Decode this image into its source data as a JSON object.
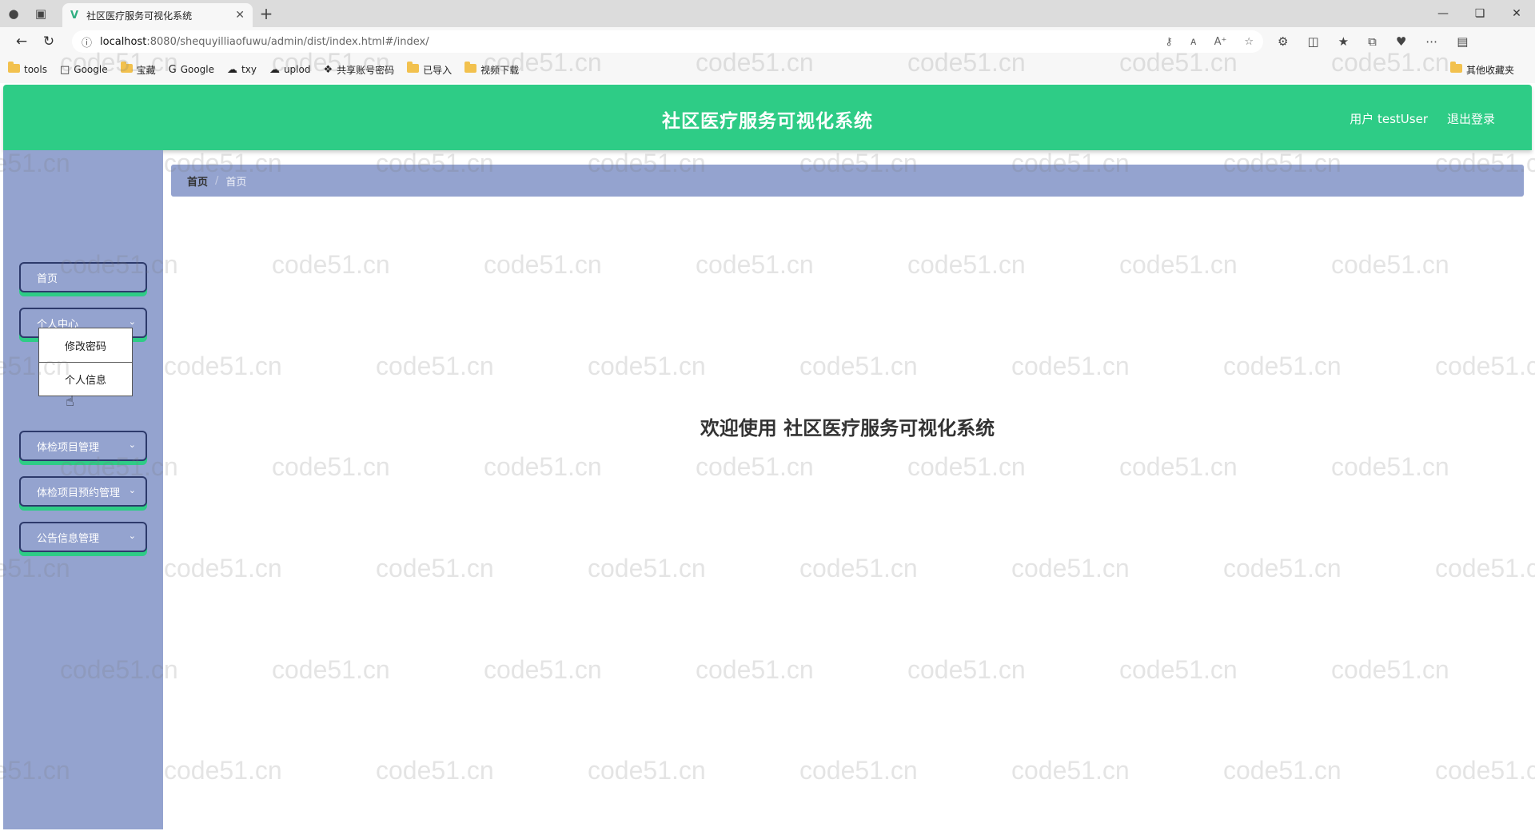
{
  "browser": {
    "tab_title": "社区医疗服务可视化系统",
    "url_host": "localhost",
    "url_path": ":8080/shequyilliaofuwu/admin/dist/index.html#/index/",
    "bookmarks": [
      "tools",
      "Google",
      "宝藏",
      "Google",
      "txy",
      "uplod",
      "共享账号密码",
      "已导入",
      "视频下载"
    ],
    "bookmarks_right": "其他收藏夹"
  },
  "header": {
    "title": "社区医疗服务可视化系统",
    "user_label": "用户 testUser",
    "logout_label": "退出登录"
  },
  "sidebar": {
    "items": [
      {
        "label": "首页"
      },
      {
        "label": "个人中心"
      },
      {
        "label": "体检项目管理"
      },
      {
        "label": "体检项目预约管理"
      },
      {
        "label": "公告信息管理"
      }
    ],
    "submenu": [
      "修改密码",
      "个人信息"
    ]
  },
  "breadcrumb": {
    "home": "首页",
    "separator": "/",
    "current": "首页"
  },
  "main": {
    "welcome": "欢迎使用 社区医疗服务可视化系统"
  },
  "watermark_text": "code51.cn",
  "colors": {
    "header": "#2ecc86",
    "sidebar": "#94a3cf",
    "breadcrumb": "#94a3cf"
  }
}
